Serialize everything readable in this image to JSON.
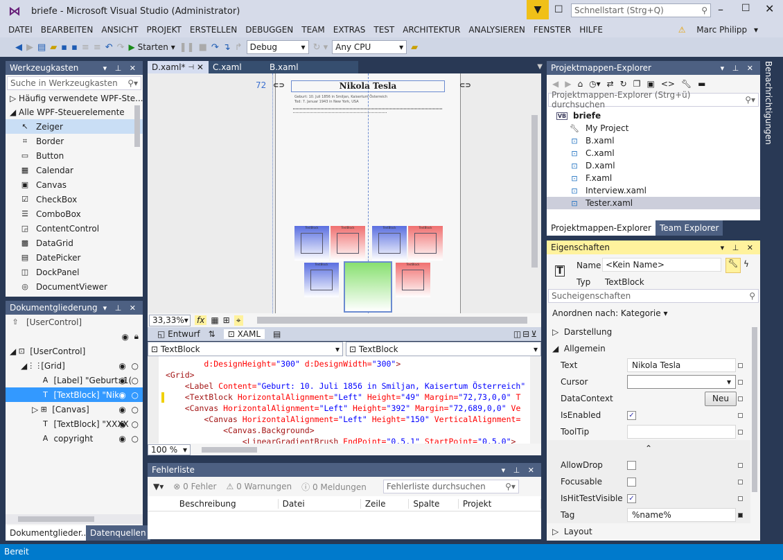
{
  "window": {
    "title": "briefe - Microsoft Visual Studio (Administrator)",
    "quicklaunch_placeholder": "Schnellstart (Strg+Q)",
    "user": "Marc Philipp"
  },
  "menu": [
    "DATEI",
    "BEARBEITEN",
    "ANSICHT",
    "PROJEKT",
    "ERSTELLEN",
    "DEBUGGEN",
    "TEAM",
    "EXTRAS",
    "TEST",
    "ARCHITEKTUR",
    "ANALYSIEREN",
    "FENSTER",
    "HILFE"
  ],
  "toolbar": {
    "start": "Starten",
    "config": "Debug",
    "platform": "Any CPU"
  },
  "toolbox": {
    "title": "Werkzeugkasten",
    "search_placeholder": "Suche in Werkzeugkasten",
    "groups": [
      "Häufig verwendete WPF-Ste...",
      "Alle WPF-Steuerelemente"
    ],
    "items": [
      {
        "label": "Zeiger",
        "icon": "pointer"
      },
      {
        "label": "Border",
        "icon": "border"
      },
      {
        "label": "Button",
        "icon": "button"
      },
      {
        "label": "Calendar",
        "icon": "calendar"
      },
      {
        "label": "Canvas",
        "icon": "canvas"
      },
      {
        "label": "CheckBox",
        "icon": "checkbox"
      },
      {
        "label": "ComboBox",
        "icon": "combobox"
      },
      {
        "label": "ContentControl",
        "icon": "contentcontrol"
      },
      {
        "label": "DataGrid",
        "icon": "datagrid"
      },
      {
        "label": "DatePicker",
        "icon": "datepicker"
      },
      {
        "label": "DockPanel",
        "icon": "dockpanel"
      },
      {
        "label": "DocumentViewer",
        "icon": "documentviewer"
      }
    ]
  },
  "outline": {
    "title": "Dokumentgliederung",
    "root": "[UserControl]",
    "items": [
      {
        "label": "[UserControl]",
        "level": 0
      },
      {
        "label": "[Grid]",
        "level": 1
      },
      {
        "label": "[Label] \"Geburt: 1(",
        "level": 2
      },
      {
        "label": "[TextBlock] \"Nikol",
        "level": 2,
        "selected": true
      },
      {
        "label": "[Canvas]",
        "level": 2
      },
      {
        "label": "[TextBlock] \"XXXX",
        "level": 2
      },
      {
        "label": "copyright",
        "level": 2
      }
    ],
    "tabs": [
      "Dokumentglieder...",
      "Datenquellen"
    ]
  },
  "editor": {
    "tabs": [
      {
        "label": "D.xaml*",
        "active": true
      },
      {
        "label": "C.xaml"
      },
      {
        "label": "B.xaml"
      }
    ],
    "designer": {
      "margin_label": "72",
      "heading": "Nikola Tesla",
      "line1": "Geburt: 10. Juli 1856 in Smiljan, Kaisertum Österreich",
      "line2": "Tod: 7. Januar 1943 in New York, USA",
      "tile_text": "TextBlock",
      "zoom": "33,33%"
    },
    "split_tabs": {
      "design": "Entwurf",
      "xaml": "XAML"
    },
    "scope_left": "TextBlock",
    "scope_right": "TextBlock",
    "code": [
      [
        [
          "attr",
          "        d:DesignHeight="
        ],
        [
          "val",
          "\"300\""
        ],
        [
          "attr",
          " d:DesignWidth="
        ],
        [
          "val",
          "\"300\""
        ],
        [
          "tag",
          ">"
        ]
      ],
      [
        [
          "tag",
          "<Grid>"
        ]
      ],
      [
        [
          "tag",
          "    <Label"
        ],
        [
          "attr",
          " Content="
        ],
        [
          "val",
          "\"Geburt: 10. Juli 1856 in Smiljan, Kaisertum Österreich\""
        ]
      ],
      [
        [
          "tag",
          "    <TextBlock"
        ],
        [
          "attr",
          " HorizontalAlignment="
        ],
        [
          "val",
          "\"Left\""
        ],
        [
          "attr",
          " Height="
        ],
        [
          "val",
          "\"49\""
        ],
        [
          "attr",
          " Margin="
        ],
        [
          "val",
          "\"72,73,0,0\""
        ],
        [
          "attr",
          " T"
        ]
      ],
      [
        [
          "tag",
          "    <Canvas"
        ],
        [
          "attr",
          " HorizontalAlignment="
        ],
        [
          "val",
          "\"Left\""
        ],
        [
          "attr",
          " Height="
        ],
        [
          "val",
          "\"392\""
        ],
        [
          "attr",
          " Margin="
        ],
        [
          "val",
          "\"72,689,0,0\""
        ],
        [
          "attr",
          " Ve"
        ]
      ],
      [
        [
          "tag",
          "        <Canvas"
        ],
        [
          "attr",
          " HorizontalAlignment="
        ],
        [
          "val",
          "\"Left\""
        ],
        [
          "attr",
          " Height="
        ],
        [
          "val",
          "\"150\""
        ],
        [
          "attr",
          " VerticalAlignment="
        ]
      ],
      [
        [
          "tag",
          "            <Canvas.Background>"
        ]
      ],
      [
        [
          "tag",
          "                <LinearGradientBrush"
        ],
        [
          "attr",
          " EndPoint="
        ],
        [
          "val",
          "\"0.5,1\""
        ],
        [
          "attr",
          " StartPoint="
        ],
        [
          "val",
          "\"0.5,0\""
        ],
        [
          "tag",
          ">"
        ]
      ]
    ],
    "code_zoom": "100 %"
  },
  "errors": {
    "title": "Fehlerliste",
    "errors": "0 Fehler",
    "warnings": "0 Warnungen",
    "messages": "0 Meldungen",
    "search_placeholder": "Fehlerliste durchsuchen",
    "columns": [
      "Beschreibung",
      "Datei",
      "Zeile",
      "Spalte",
      "Projekt"
    ]
  },
  "solution": {
    "title": "Projektmappen-Explorer",
    "search_placeholder": "Projektmappen-Explorer (Strg+ü) durchsuchen",
    "project": "briefe",
    "items": [
      {
        "label": "My Project",
        "icon": "wrench"
      },
      {
        "label": "B.xaml",
        "icon": "xaml"
      },
      {
        "label": "C.xaml",
        "icon": "xaml"
      },
      {
        "label": "D.xaml",
        "icon": "xaml"
      },
      {
        "label": "F.xaml",
        "icon": "xaml"
      },
      {
        "label": "Interview.xaml",
        "icon": "xaml"
      },
      {
        "label": "Tester.xaml",
        "icon": "xaml",
        "selected": true
      }
    ],
    "tabs": [
      "Projektmappen-Explorer",
      "Team Explorer"
    ]
  },
  "properties": {
    "title": "Eigenschaften",
    "name_label": "Name",
    "name_value": "<Kein Name>",
    "type_label": "Typ",
    "type_value": "TextBlock",
    "search_placeholder": "Sucheigenschaften",
    "arrange": "Anordnen nach: Kategorie",
    "cat_collapsed": "Darstellung",
    "cat_open": "Allgemein",
    "cat_layout": "Layout",
    "text_label": "Text",
    "text_value": "Nikola Tesla",
    "cursor_label": "Cursor",
    "datacontext_label": "DataContext",
    "new_button": "Neu",
    "isenabled_label": "IsEnabled",
    "isenabled": true,
    "tooltip_label": "ToolTip",
    "allowdrop_label": "AllowDrop",
    "allowdrop": false,
    "focusable_label": "Focusable",
    "focusable": false,
    "hittest_label": "IsHitTestVisible",
    "hittest": true,
    "tag_label": "Tag",
    "tag_value": "%name%"
  },
  "notifications": "Benachrichtigungen",
  "status": "Bereit",
  "colors": {
    "accent": "#007ACC",
    "active_header": "#FFF29D",
    "selection": "#3399FF"
  }
}
